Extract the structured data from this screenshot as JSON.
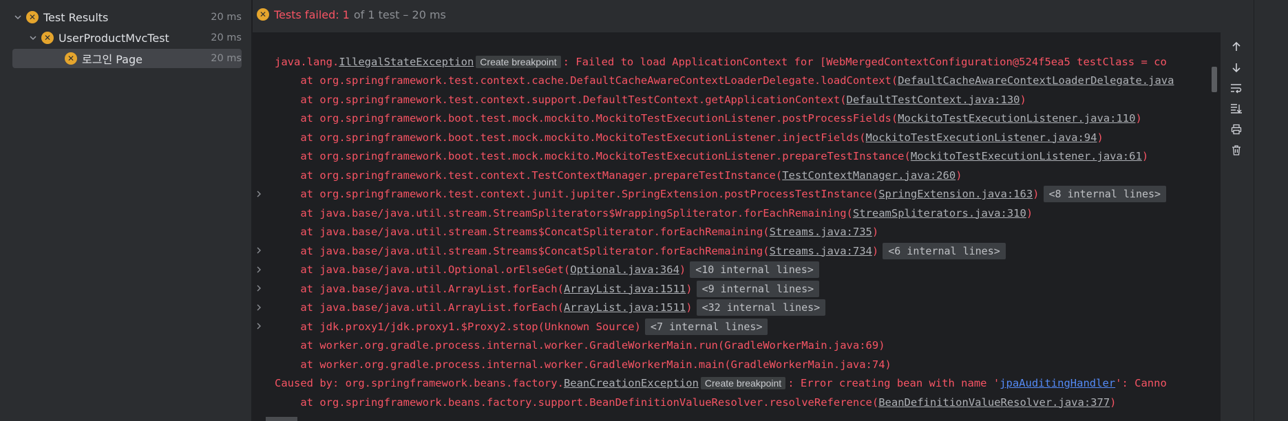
{
  "tree": {
    "root": {
      "label": "Test Results",
      "duration": "20 ms"
    },
    "suite": {
      "label": "UserProductMvcTest",
      "duration": "20 ms"
    },
    "test": {
      "label": "로그인 Page",
      "duration": "20 ms"
    }
  },
  "status": {
    "failed_label": "Tests failed:",
    "failed_count": "1",
    "rest": "of 1 test – 20 ms"
  },
  "console": {
    "breakpoint_label": "Create breakpoint",
    "lines": [
      {
        "pre": "java.lang.",
        "link": "IllegalStateException",
        "bp": true,
        "post": ": Failed to load ApplicationContext for [WebMergedContextConfiguration@524f5ea5 testClass = co"
      },
      {
        "pre": "    at org.springframework.test.context.cache.DefaultCacheAwareContextLoaderDelegate.loadContext(",
        "link": "DefaultCacheAwareContextLoaderDelegate.java",
        "post": ""
      },
      {
        "pre": "    at org.springframework.test.context.support.DefaultTestContext.getApplicationContext(",
        "link": "DefaultTestContext.java:130",
        "post": ")"
      },
      {
        "pre": "    at org.springframework.boot.test.mock.mockito.MockitoTestExecutionListener.postProcessFields(",
        "link": "MockitoTestExecutionListener.java:110",
        "post": ")"
      },
      {
        "pre": "    at org.springframework.boot.test.mock.mockito.MockitoTestExecutionListener.injectFields(",
        "link": "MockitoTestExecutionListener.java:94",
        "post": ")"
      },
      {
        "pre": "    at org.springframework.boot.test.mock.mockito.MockitoTestExecutionListener.prepareTestInstance(",
        "link": "MockitoTestExecutionListener.java:61",
        "post": ")"
      },
      {
        "pre": "    at org.springframework.test.context.TestContextManager.prepareTestInstance(",
        "link": "TestContextManager.java:260",
        "post": ")"
      },
      {
        "pre": "    at org.springframework.test.context.junit.jupiter.SpringExtension.postProcessTestInstance(",
        "link": "SpringExtension.java:163",
        "post": ")",
        "fold": "<8 internal lines>",
        "expand": true
      },
      {
        "pre": "    at java.base/java.util.stream.StreamSpliterators$WrappingSpliterator.forEachRemaining(",
        "link": "StreamSpliterators.java:310",
        "post": ")"
      },
      {
        "pre": "    at java.base/java.util.stream.Streams$ConcatSpliterator.forEachRemaining(",
        "link": "Streams.java:735",
        "post": ")"
      },
      {
        "pre": "    at java.base/java.util.stream.Streams$ConcatSpliterator.forEachRemaining(",
        "link": "Streams.java:734",
        "post": ")",
        "fold": "<6 internal lines>",
        "expand": true
      },
      {
        "pre": "    at java.base/java.util.Optional.orElseGet(",
        "link": "Optional.java:364",
        "post": ")",
        "fold": "<10 internal lines>",
        "expand": true
      },
      {
        "pre": "    at java.base/java.util.ArrayList.forEach(",
        "link": "ArrayList.java:1511",
        "post": ")",
        "fold": "<9 internal lines>",
        "expand": true
      },
      {
        "pre": "    at java.base/java.util.ArrayList.forEach(",
        "link": "ArrayList.java:1511",
        "post": ")",
        "fold": "<32 internal lines>",
        "expand": true
      },
      {
        "pre": "    at jdk.proxy1/jdk.proxy1.$Proxy2.stop(Unknown Source)",
        "link": "",
        "post": "",
        "fold": "<7 internal lines>",
        "expand": true
      },
      {
        "pre": "    at worker.org.gradle.process.internal.worker.GradleWorkerMain.run(GradleWorkerMain.java:69)",
        "link": "",
        "post": ""
      },
      {
        "pre": "    at worker.org.gradle.process.internal.worker.GradleWorkerMain.main(GradleWorkerMain.java:74)",
        "link": "",
        "post": ""
      },
      {
        "pre": "Caused by: org.springframework.beans.factory.",
        "link": "BeanCreationException",
        "bp": true,
        "post": ": Error creating bean with name '",
        "link2": "jpaAuditingHandler",
        "post2": "': Canno"
      },
      {
        "pre": "    at org.springframework.beans.factory.support.BeanDefinitionValueResolver.resolveReference(",
        "link": "BeanDefinitionValueResolver.java:377",
        "post": ")"
      }
    ]
  },
  "toolbar": {
    "icons": [
      "arrow-up-icon",
      "arrow-down-icon",
      "soft-wrap-icon",
      "scroll-to-end-icon",
      "print-icon",
      "trash-icon"
    ]
  }
}
